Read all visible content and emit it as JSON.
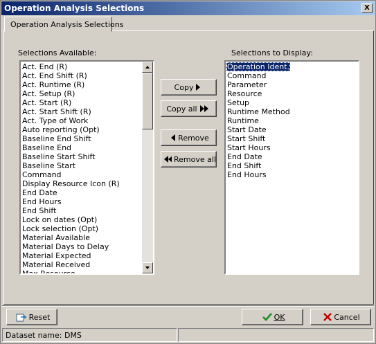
{
  "window": {
    "title": "Operation Analysis Selections",
    "close_label": "X"
  },
  "tabs": [
    {
      "label": "Operation Analysis Selections"
    }
  ],
  "available": {
    "label": "Selections Available:",
    "items": [
      "Act. End (R)",
      "Act. End Shift (R)",
      "Act. Runtime (R)",
      "Act. Setup (R)",
      "Act. Start (R)",
      "Act. Start Shift (R)",
      "Act. Type of Work",
      "Auto reporting (Opt)",
      "Baseline End Shift",
      "Baseline End",
      "Baseline Start Shift",
      "Baseline Start",
      "Command",
      "Display Resource Icon (R)",
      "End Date",
      "End Hours",
      "End Shift",
      "Lock on dates (Opt)",
      "Lock selection (Opt)",
      "Material Available",
      "Material Days to Delay",
      "Material Expected",
      "Material Received",
      "Max Resource"
    ]
  },
  "display": {
    "label": "Selections to Display:",
    "items": [
      "Operation Ident.",
      "Command",
      "Parameter",
      "Resource",
      "Setup",
      "Runtime Method",
      "Runtime",
      "Start Date",
      "Start Shift",
      "Start Hours",
      "End Date",
      "End Shift",
      "End Hours"
    ],
    "selected_index": 0
  },
  "buttons": {
    "copy": "Copy",
    "copy_all": "Copy all",
    "remove": "Remove",
    "remove_all": "Remove all",
    "reset": "Reset",
    "ok": "OK",
    "cancel": "Cancel"
  },
  "status": {
    "dataset": "Dataset name:  DMS",
    "secondary": ""
  },
  "icons": [
    "close-icon",
    "copy-arrow-icon",
    "copy-all-arrow-icon",
    "remove-arrow-icon",
    "remove-all-arrow-icon",
    "reset-icon",
    "ok-check-icon",
    "cancel-x-icon",
    "scroll-up-icon",
    "scroll-down-icon"
  ],
  "colors": {
    "titlebar_start": "#0a246a",
    "titlebar_end": "#a6caf0",
    "selection": "#0a246a",
    "ok_check": "#1a8a1a",
    "cancel_x": "#c00000"
  }
}
